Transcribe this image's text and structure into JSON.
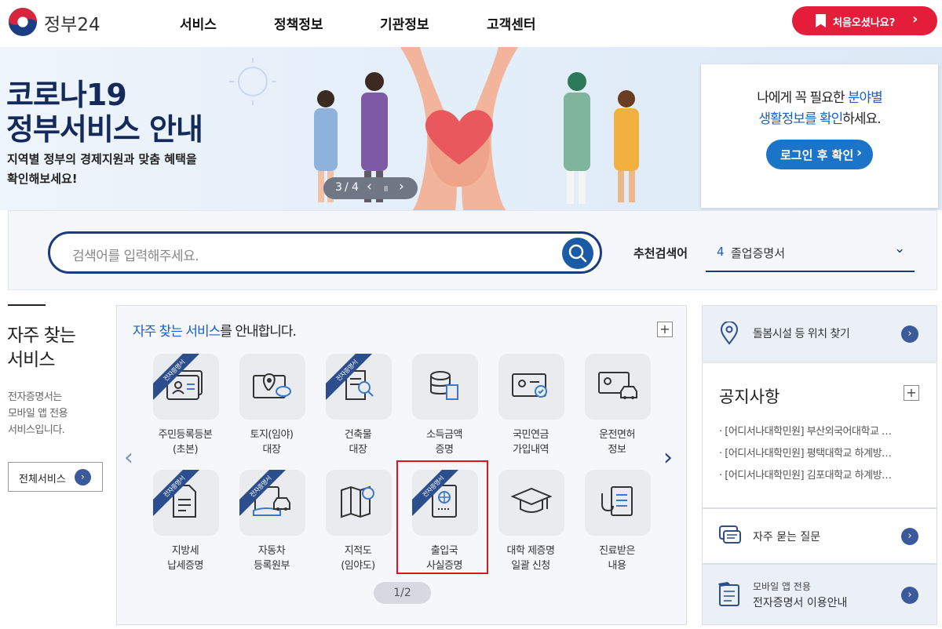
{
  "header": {
    "logo_text": "정부24",
    "nav": [
      "서비스",
      "정책정보",
      "기관정보",
      "고객센터"
    ],
    "first_visit_label": "처음오셨나요?",
    "first_visit_chevron": "›"
  },
  "banner": {
    "title_line1": "코로나19",
    "title_line2": "정부서비스 안내",
    "subtitle_line1": "지역별 정부의 경제지원과 맞춤 혜택을",
    "subtitle_line2": "확인해보세요!",
    "pager": {
      "current": "3",
      "separator": "/",
      "total": "4",
      "prev": "‹",
      "pause": "॥",
      "next": "›"
    }
  },
  "login_box": {
    "line1_a": "나에게 꼭 필요한 ",
    "line1_b": "분야별",
    "line2_a": "생활정보를 확인",
    "line2_b": "하세요.",
    "button_label": "로그인 후 확인",
    "button_chevron": "›"
  },
  "search": {
    "placeholder": "검색어를 입력해주세요.",
    "recommend_label": "추천검색어",
    "recommend_number": "4",
    "recommend_term": "졸업증명서",
    "dropdown_chevron": "⌄"
  },
  "side": {
    "title_line1": "자주 찾는",
    "title_line2": "서비스",
    "desc": [
      "전자증명서는",
      "모바일 앱 전용",
      "서비스입니다."
    ],
    "all_button_label": "전체서비스",
    "all_button_chevron": "›"
  },
  "services_panel": {
    "title_highlight": "자주 찾는 서비스",
    "title_rest": "를 안내합니다.",
    "plus": "+",
    "ribbon_text": "전자증명서",
    "prev_arrow": "‹",
    "next_arrow": "›",
    "page": "1/2",
    "items": [
      {
        "icon": "resident-card-icon",
        "line1": "주민등록등본",
        "line2": "(초본)",
        "ribbon": true
      },
      {
        "icon": "land-map-icon",
        "line1": "토지(임야)",
        "line2": "대장",
        "ribbon": false
      },
      {
        "icon": "building-doc-icon",
        "line1": "건축물",
        "line2": "대장",
        "ribbon": true
      },
      {
        "icon": "income-coins-icon",
        "line1": "소득금액",
        "line2": "증명",
        "ribbon": false
      },
      {
        "icon": "pension-check-icon",
        "line1": "국민연금",
        "line2": "가입내역",
        "ribbon": false
      },
      {
        "icon": "driver-license-icon",
        "line1": "운전면허",
        "line2": "정보",
        "ribbon": false
      },
      {
        "icon": "tax-document-icon",
        "line1": "지방세",
        "line2": "납세증명",
        "ribbon": true
      },
      {
        "icon": "vehicle-register-icon",
        "line1": "자동차",
        "line2": "등록원부",
        "ribbon": true
      },
      {
        "icon": "cadastral-map-icon",
        "line1": "지적도",
        "line2": "(임야도)",
        "ribbon": false
      },
      {
        "icon": "passport-icon",
        "line1": "출입국",
        "line2": "사실증명",
        "ribbon": true
      },
      {
        "icon": "graduation-cap-icon",
        "line1": "대학 제증명",
        "line2": "일괄 신청",
        "ribbon": false
      },
      {
        "icon": "medical-chart-icon",
        "line1": "진료받은",
        "line2": "내용",
        "ribbon": false
      }
    ]
  },
  "right_panel": {
    "location_label": "돌봄시설 등 위치 찾기",
    "notice_title": "공지사항",
    "notice_plus": "+",
    "notices": [
      "· [어디서나대학민원] 부산외국어대학교 …",
      "· [어디서나대학민원] 평택대학교 하계방…",
      "· [어디서나대학민원] 김포대학교 하계방…"
    ],
    "faq_label": "자주 묻는 질문",
    "app_line1": "모바일 앱 전용",
    "app_line2": "전자증명서 이용안내",
    "chevron": "›"
  },
  "colors": {
    "brand_red": "#e31d3a",
    "navy": "#1b3a80",
    "accent_blue": "#1a5fc6",
    "ribbon": "#2c4e8d",
    "highlight_border": "#e0141e"
  }
}
